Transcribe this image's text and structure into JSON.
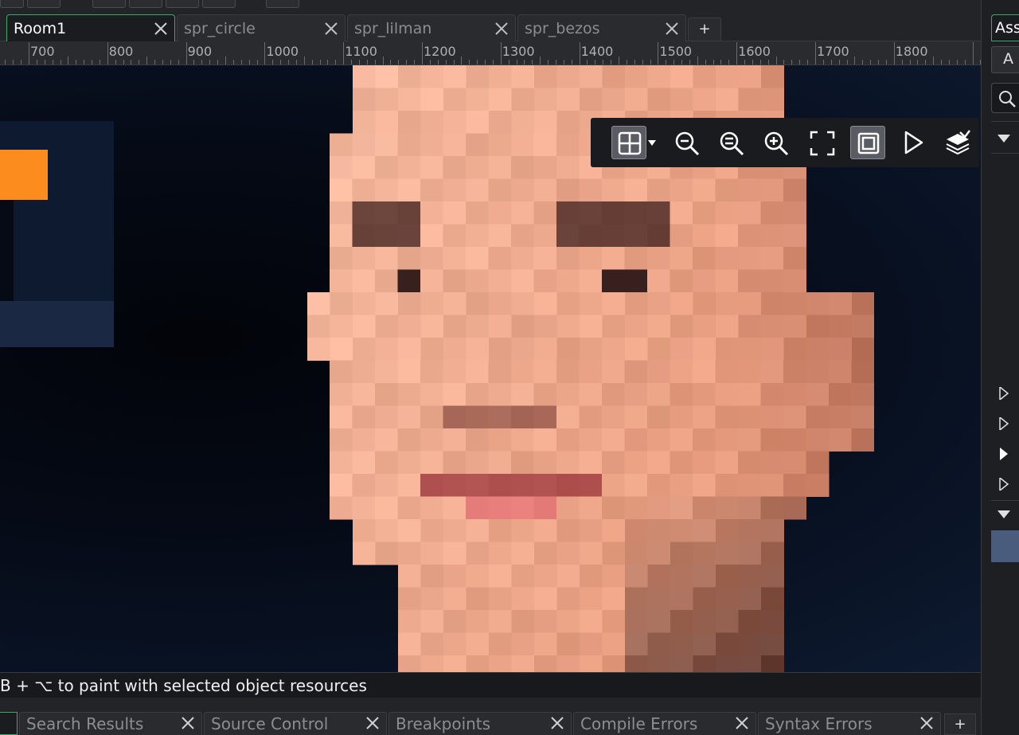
{
  "tabs": [
    {
      "label": "Room1",
      "active": true
    },
    {
      "label": "spr_circle",
      "active": false
    },
    {
      "label": "spr_lilman",
      "active": false
    },
    {
      "label": "spr_bezos",
      "active": false
    }
  ],
  "tab_add_label": "+",
  "assets": {
    "tab_label": "Ass",
    "button_label": "A"
  },
  "ruler": {
    "labels": [
      "700",
      "800",
      "900",
      "1000",
      "1100",
      "1200",
      "1300",
      "1400",
      "1500",
      "1600",
      "1700",
      "1800"
    ]
  },
  "view_toolbar": {
    "buttons": [
      {
        "icon": "grid-icon",
        "active": true
      },
      {
        "icon": "zoom-out-icon",
        "active": false
      },
      {
        "icon": "zoom-reset-icon",
        "active": false
      },
      {
        "icon": "zoom-in-icon",
        "active": false
      },
      {
        "icon": "fit-view-icon",
        "active": false
      },
      {
        "icon": "frame-icon",
        "active": true
      },
      {
        "icon": "play-icon",
        "active": false
      },
      {
        "icon": "layers-icon",
        "active": false
      }
    ]
  },
  "status": {
    "text": "B + ⌥ to paint with selected object resources"
  },
  "bottom_tabs": [
    {
      "label": "Search Results"
    },
    {
      "label": "Source Control"
    },
    {
      "label": "Breakpoints"
    },
    {
      "label": "Compile Errors"
    },
    {
      "label": "Syntax Errors"
    }
  ],
  "bottom_add_label": "+",
  "colors": {
    "accent": "#3aa86b",
    "canvas_bg": "#0d1a30",
    "orange_instance": "#fb8c1d",
    "selected_row": "#4a5c7d"
  }
}
